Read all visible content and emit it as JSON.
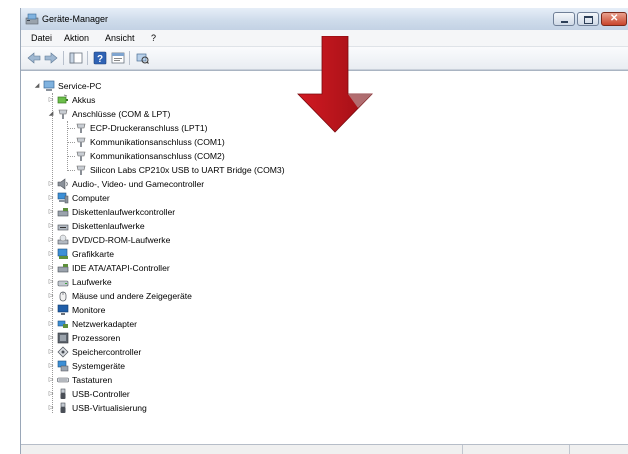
{
  "window": {
    "title": "Geräte-Manager"
  },
  "menu": {
    "items": [
      "Datei",
      "Aktion",
      "Ansicht",
      "?"
    ]
  },
  "tree": {
    "root": "Service-PC",
    "items": [
      {
        "label": "Akkus",
        "icon": "battery-icon",
        "expanded": false
      },
      {
        "label": "Anschlüsse (COM & LPT)",
        "icon": "port-icon",
        "expanded": true,
        "children": [
          "ECP-Druckeranschluss (LPT1)",
          "Kommunikationsanschluss (COM1)",
          "Kommunikationsanschluss (COM2)",
          "Silicon Labs CP210x USB to UART Bridge (COM3)"
        ]
      },
      {
        "label": "Audio-, Video- und Gamecontroller",
        "icon": "speaker-icon",
        "expanded": false
      },
      {
        "label": "Computer",
        "icon": "computer-icon",
        "expanded": false
      },
      {
        "label": "Diskettenlaufwerkcontroller",
        "icon": "floppy-controller-icon",
        "expanded": false
      },
      {
        "label": "Diskettenlaufwerke",
        "icon": "floppy-drive-icon",
        "expanded": false
      },
      {
        "label": "DVD/CD-ROM-Laufwerke",
        "icon": "optical-drive-icon",
        "expanded": false
      },
      {
        "label": "Grafikkarte",
        "icon": "graphics-card-icon",
        "expanded": false
      },
      {
        "label": "IDE ATA/ATAPI-Controller",
        "icon": "ide-controller-icon",
        "expanded": false
      },
      {
        "label": "Laufwerke",
        "icon": "disk-drive-icon",
        "expanded": false
      },
      {
        "label": "Mäuse und andere Zeigegeräte",
        "icon": "mouse-icon",
        "expanded": false
      },
      {
        "label": "Monitore",
        "icon": "monitor-icon",
        "expanded": false
      },
      {
        "label": "Netzwerkadapter",
        "icon": "network-adapter-icon",
        "expanded": false
      },
      {
        "label": "Prozessoren",
        "icon": "processor-icon",
        "expanded": false
      },
      {
        "label": "Speichercontroller",
        "icon": "storage-controller-icon",
        "expanded": false
      },
      {
        "label": "Systemgeräte",
        "icon": "system-devices-icon",
        "expanded": false
      },
      {
        "label": "Tastaturen",
        "icon": "keyboard-icon",
        "expanded": false
      },
      {
        "label": "USB-Controller",
        "icon": "usb-icon",
        "expanded": false
      },
      {
        "label": "USB-Virtualisierung",
        "icon": "usb-icon",
        "expanded": false
      }
    ]
  },
  "colors": {
    "annotation_arrow": "#c0141c",
    "title_gradient": "#cfdceb",
    "close_button": "#c9452c"
  }
}
